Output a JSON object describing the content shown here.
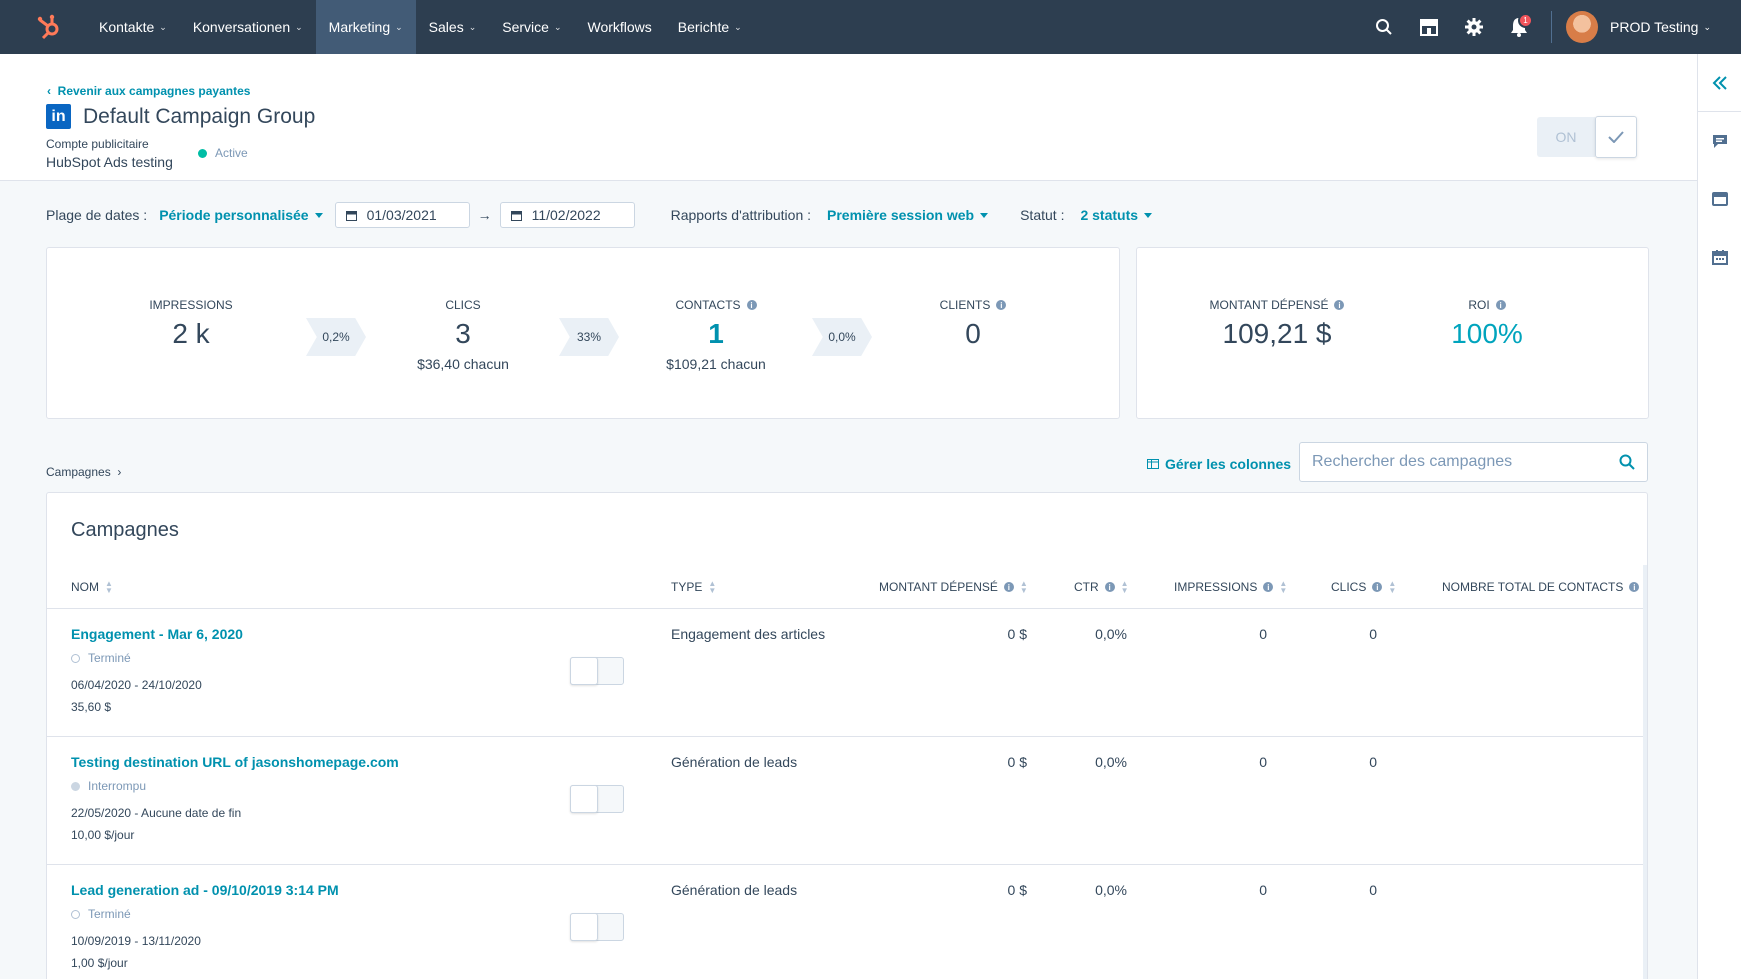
{
  "nav": {
    "logo": "hubspot-sprocket",
    "items": [
      {
        "label": "Kontakte",
        "active": false,
        "dropdown": true
      },
      {
        "label": "Konversationen",
        "active": false,
        "dropdown": true
      },
      {
        "label": "Marketing",
        "active": true,
        "dropdown": true
      },
      {
        "label": "Sales",
        "active": false,
        "dropdown": true
      },
      {
        "label": "Service",
        "active": false,
        "dropdown": true
      },
      {
        "label": "Workflows",
        "active": false,
        "dropdown": false
      },
      {
        "label": "Berichte",
        "active": false,
        "dropdown": true
      }
    ],
    "notification_count": "1",
    "account_name": "PROD Testing"
  },
  "header": {
    "back_link": "Revenir aux campagnes payantes",
    "title": "Default Campaign Group",
    "account_label": "Compte publicitaire",
    "account_name": "HubSpot Ads testing",
    "status": "Active",
    "toggle_label": "ON"
  },
  "filters": {
    "date_range_label": "Plage de dates :",
    "date_range_value": "Période personnalisée",
    "start_date": "01/03/2021",
    "end_date": "11/02/2022",
    "attribution_label": "Rapports d'attribution :",
    "attribution_value": "Première session web",
    "status_label": "Statut :",
    "status_value": "2 statuts"
  },
  "funnel": {
    "impressions": {
      "label": "IMPRESSIONS",
      "value": "2 k"
    },
    "rate1": "0,2%",
    "clicks": {
      "label": "CLICS",
      "value": "3",
      "sub": "$36,40 chacun"
    },
    "rate2": "33%",
    "contacts": {
      "label": "CONTACTS",
      "value": "1",
      "sub": "$109,21 chacun"
    },
    "rate3": "0,0%",
    "customers": {
      "label": "CLIENTS",
      "value": "0"
    }
  },
  "spend": {
    "spent": {
      "label": "MONTANT DÉPENSÉ",
      "value": "109,21 $"
    },
    "roi": {
      "label": "ROI",
      "value": "100%"
    }
  },
  "table": {
    "breadcrumb": "Campagnes",
    "manage_columns": "Gérer les colonnes",
    "search_placeholder": "Rechercher des campagnes",
    "title": "Campagnes",
    "columns": [
      "NOM",
      "TYPE",
      "MONTANT DÉPENSÉ",
      "CTR",
      "IMPRESSIONS",
      "CLICS",
      "NOMBRE TOTAL DE CONTACTS"
    ],
    "rows": [
      {
        "name": "Engagement - Mar 6, 2020",
        "status": "Terminé",
        "status_style": "ring",
        "dates": "06/04/2020 - 24/10/2020",
        "budget": "35,60 $",
        "type": "Engagement des articles",
        "spent": "0 $",
        "ctr": "0,0%",
        "impressions": "0",
        "clicks": "0"
      },
      {
        "name": "Testing destination URL of jasonshomepage.com",
        "status": "Interrompu",
        "status_style": "filled",
        "dates": "22/05/2020 - Aucune date de fin",
        "budget": "10,00 $/jour",
        "type": "Génération de leads",
        "spent": "0 $",
        "ctr": "0,0%",
        "impressions": "0",
        "clicks": "0"
      },
      {
        "name": "Lead generation ad - 09/10/2019 3:14 PM",
        "status": "Terminé",
        "status_style": "ring",
        "dates": "10/09/2019 - 13/11/2020",
        "budget": "1,00 $/jour",
        "type": "Génération de leads",
        "spent": "0 $",
        "ctr": "0,0%",
        "impressions": "0",
        "clicks": "0"
      }
    ]
  },
  "colors": {
    "nav_bg": "#2d3e50",
    "accent": "#0091ae",
    "active_green": "#00bda5",
    "linkedin": "#0a66c2"
  }
}
